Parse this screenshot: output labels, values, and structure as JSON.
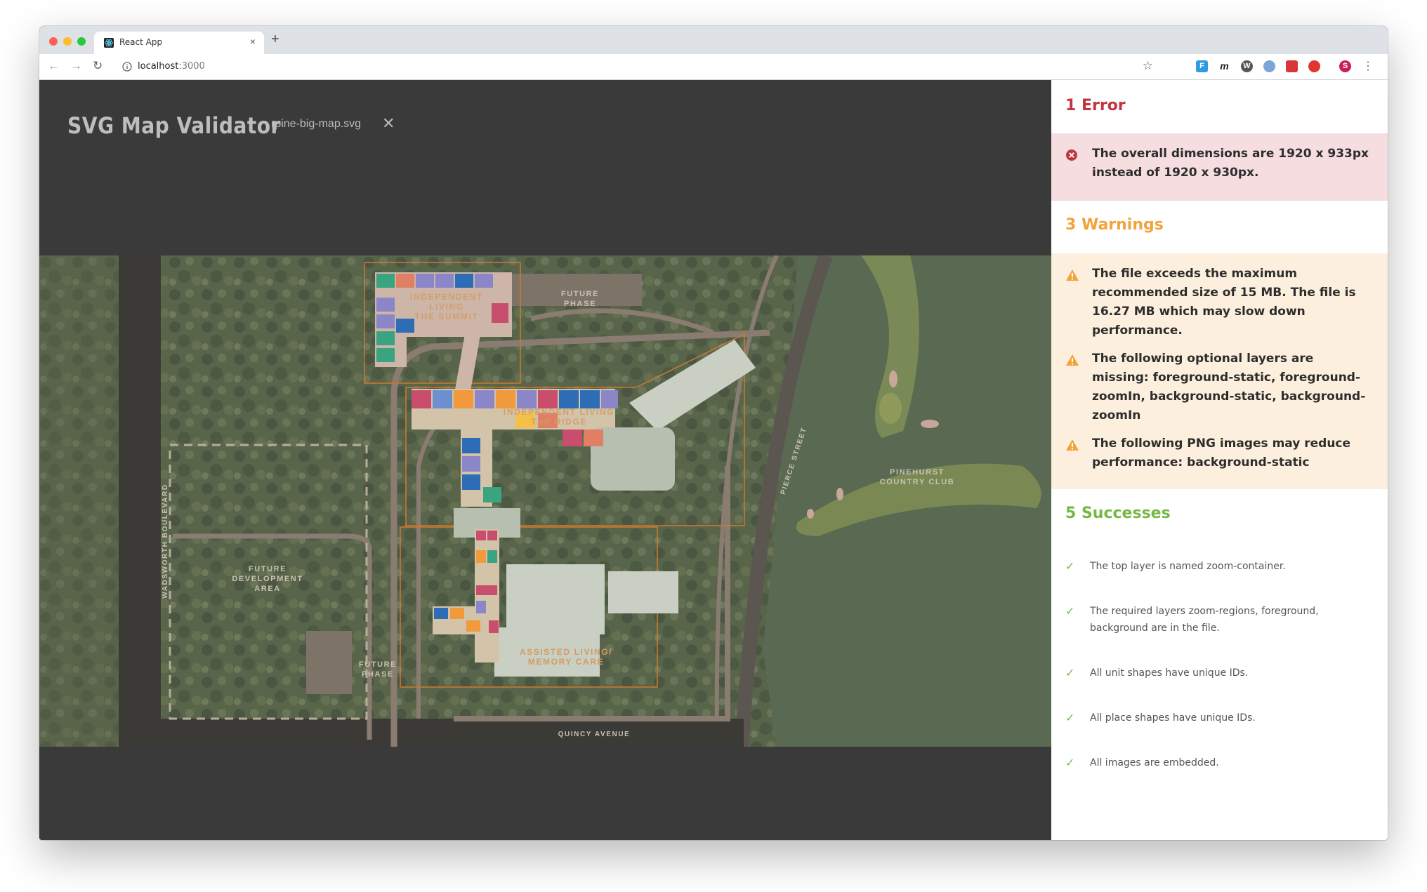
{
  "browser": {
    "tab_title": "React App",
    "tab_close": "×",
    "new_tab": "+",
    "url_host": "localhost",
    "url_port": ":3000",
    "back": "←",
    "forward": "→",
    "reload": "↻",
    "star": "☆",
    "menu": "⋮",
    "profile_initial": "S",
    "extensions": [
      "extension-f-icon",
      "extension-m-icon",
      "extension-w-icon",
      "extension-compass-icon",
      "extension-photo-icon",
      "extension-shield-icon"
    ]
  },
  "app": {
    "title": "SVG Map Validator",
    "file_name": "rpine-big-map.svg",
    "close_file": "✕"
  },
  "map": {
    "labels": {
      "future_phase_top": "FUTURE\nPHASE",
      "independent_summit": "INDEPENDENT\nLIVING\nTHE SUMMIT",
      "independent_ridge": "INDEPENDENT LIVING\nTHE RIDGE",
      "pinehurst": "PINEHURST\nCOUNTRY CLUB",
      "pierce": "PIERCE STREET",
      "wadsworth": "WADSWORTH BOULEVARD",
      "future_dev": "FUTURE\nDEVELOPMENT\nAREA",
      "future_phase_bottom": "FUTURE\nPHASE",
      "assisted": "ASSISTED LIVING/\nMEMORY CARE",
      "quincy": "QUINCY AVENUE"
    }
  },
  "errors": {
    "title": "1 Error",
    "items": [
      "The overall dimensions are 1920 x 933px instead of 1920 x 930px."
    ]
  },
  "warnings": {
    "title": "3 Warnings",
    "items": [
      "The file exceeds the maximum recommended size of 15 MB. The file is 16.27 MB which may slow down performance.",
      "The following optional layers are missing: foreground-static, foreground-zoomIn, background-static, background-zoomIn",
      "The following PNG images may reduce performance: background-static"
    ]
  },
  "successes": {
    "title": "5 Successes",
    "items": [
      "The top layer is named zoom-container.",
      "The required layers zoom-regions, foreground, background are in the file.",
      "All unit shapes have unique IDs.",
      "All place shapes have unique IDs.",
      "All images are embedded."
    ]
  },
  "colors": {
    "error": "#c23540",
    "warning": "#f2a33c",
    "success": "#76b845",
    "app_bg": "#3a3a3a"
  }
}
